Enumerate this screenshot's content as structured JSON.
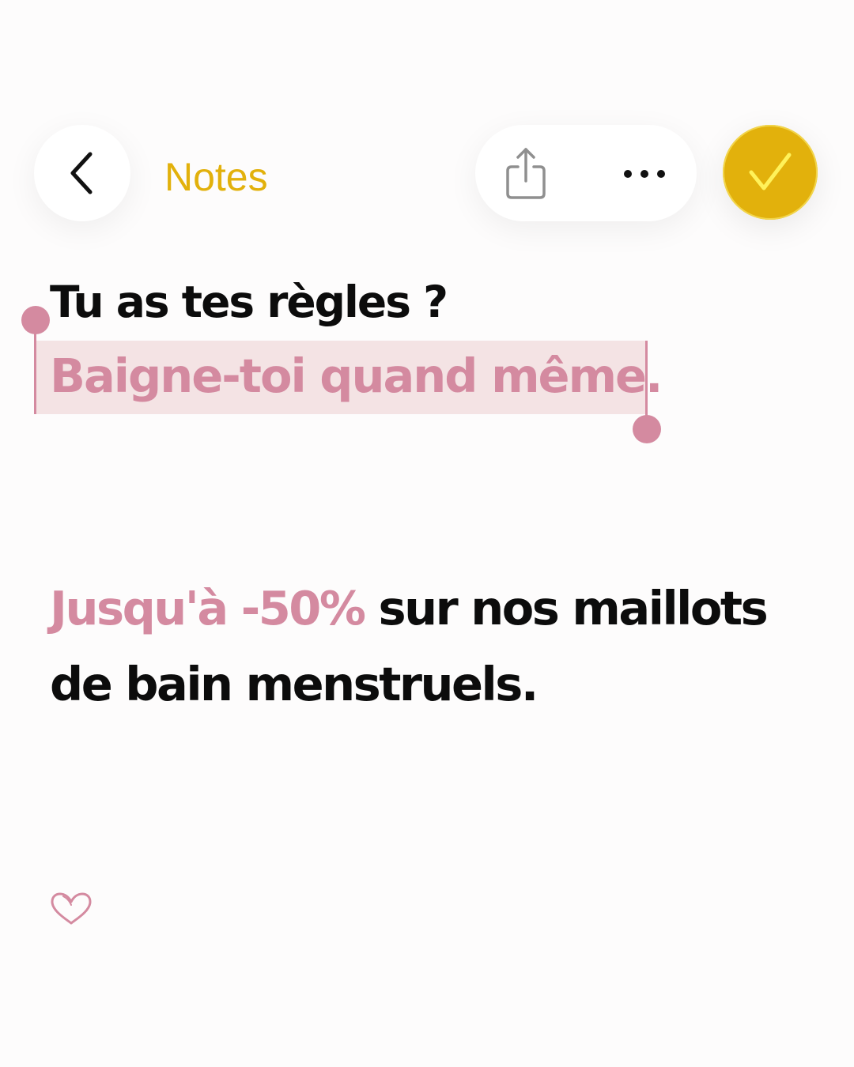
{
  "toolbar": {
    "back_label": "Notes",
    "back_icon": "chevron-left-icon",
    "share_icon": "share-icon",
    "more_icon": "ellipsis-icon",
    "done_icon": "checkmark-icon"
  },
  "note": {
    "title": "Tu as tes règles ?",
    "selected_line": "Baigne-toi quand même.",
    "promo_highlight": "Jusqu'à -50%",
    "promo_rest": " sur nos maillots de bain menstruels.",
    "footer_icon": "heart-icon"
  },
  "colors": {
    "accent_yellow": "#e2b10c",
    "accent_pink": "#d48aa0",
    "selection_bg": "#f4e3e4",
    "text": "#0c0c0c",
    "background": "#fdfcfc"
  }
}
